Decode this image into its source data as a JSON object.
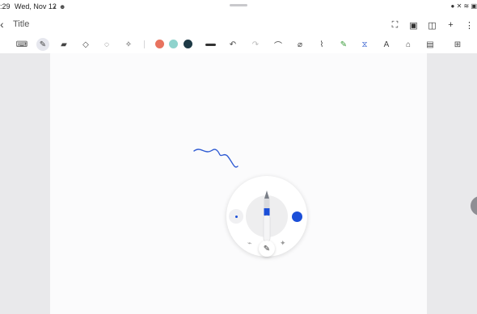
{
  "status_bar": {
    "time": ":29",
    "date": "Wed, Nov 12",
    "left_icons": "◐ ☻",
    "right_icons": "● ✕ ≋ ▣"
  },
  "header": {
    "back_label": "‹",
    "title": "Title",
    "actions": [
      "⛶",
      "▣",
      "◫",
      "+",
      "⋮"
    ]
  },
  "toolbar": {
    "tools": [
      {
        "name": "keyboard",
        "glyph": "⌨",
        "active": false
      },
      {
        "name": "pen",
        "glyph": "✎",
        "active": true
      },
      {
        "name": "highlighter",
        "glyph": "▰",
        "active": false
      },
      {
        "name": "eraser",
        "glyph": "◇",
        "active": false
      },
      {
        "name": "lasso",
        "glyph": "◌",
        "active": false
      },
      {
        "name": "magic",
        "glyph": "✧",
        "active": false
      }
    ],
    "colors": [
      "#e8735f",
      "#8fd3cd",
      "#1e3a46"
    ],
    "stroke_width": "thick",
    "actions": [
      "↶",
      "↷",
      "⌒",
      "⌀",
      "⌇",
      "✎",
      "⧖",
      "A",
      "⌂",
      "▤",
      "⊞"
    ]
  },
  "canvas": {
    "ink_color": "#2f5bd3"
  },
  "pen_palette": {
    "size": "small",
    "color": "#1b4fd8",
    "tools": [
      "⌁",
      "✎",
      "✦"
    ]
  }
}
